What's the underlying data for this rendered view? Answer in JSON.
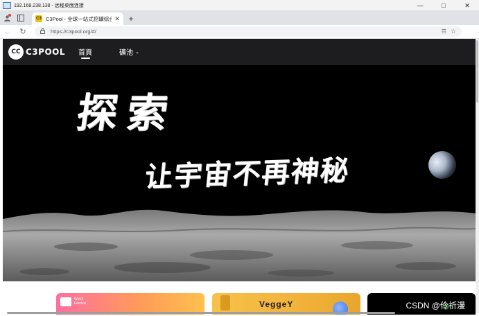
{
  "remote_window": {
    "title": "192.168.238.138 - 远程桌面连接",
    "controls": [
      "minimize-icon",
      "maximize-icon",
      "close-icon"
    ]
  },
  "browser": {
    "tab": {
      "title": "C3Pool - 全球一站式挖礦综合服",
      "favicon": "C3"
    },
    "address": {
      "url": "https://c3pool.org/#/"
    }
  },
  "site": {
    "logo_mark": "CC",
    "logo_text": "C3POOL",
    "nav": {
      "home": "首頁",
      "pools": "礦池"
    }
  },
  "hero": {
    "title": "探索",
    "subtitle": "让宇宙不再神秘"
  },
  "cards": {
    "card_a": {
      "brand": "Web3\nFestival"
    },
    "card_b": {
      "brand": "VeggeY"
    }
  },
  "watermark": "CSDN @伶祈漫",
  "colors": {
    "nav_bg": "#1d1d1f",
    "hero_bg": "#000000",
    "accent_yellow": "#f4c20d"
  }
}
